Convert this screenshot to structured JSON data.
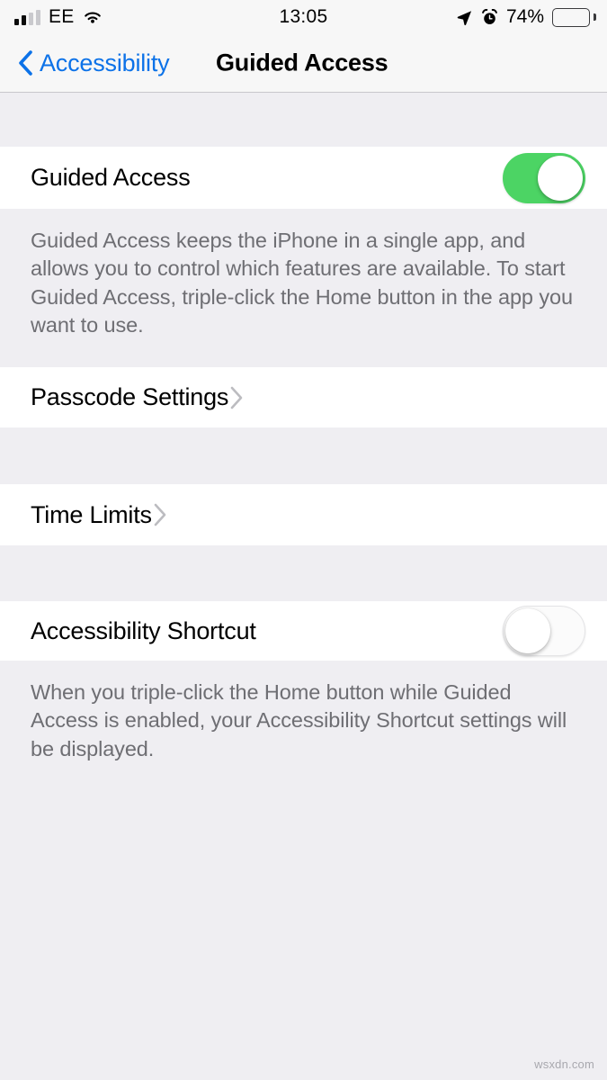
{
  "status_bar": {
    "carrier": "EE",
    "signal_bars_filled": 2,
    "signal_bars_total": 4,
    "wifi": "wifi-icon",
    "time": "13:05",
    "location_icon": "location-arrow-icon",
    "alarm_icon": "alarm-clock-icon",
    "battery_percent": "74%",
    "battery_level": 74
  },
  "nav": {
    "back_label": "Accessibility",
    "back_icon": "chevron-left-icon",
    "title": "Guided Access"
  },
  "sections": {
    "guided_access": {
      "row_label": "Guided Access",
      "toggle_state": "on",
      "footer": "Guided Access keeps the iPhone in a single app, and allows you to control which features are available. To start Guided Access, triple-click the Home button in the app you want to use."
    },
    "passcode": {
      "row_label": "Passcode Settings",
      "chevron_icon": "chevron-right-icon"
    },
    "time_limits": {
      "row_label": "Time Limits",
      "chevron_icon": "chevron-right-icon"
    },
    "accessibility_shortcut": {
      "row_label": "Accessibility Shortcut",
      "toggle_state": "off",
      "footer": "When you triple-click the Home button while Guided Access is enabled, your Accessibility Shortcut settings will be displayed."
    }
  },
  "watermark": "wsxdn.com",
  "colors": {
    "accent_blue": "#0c72e8",
    "toggle_on_green": "#4cd464",
    "group_background": "#efeef2",
    "cell_background": "#ffffff",
    "secondary_text": "#6e6e73"
  }
}
